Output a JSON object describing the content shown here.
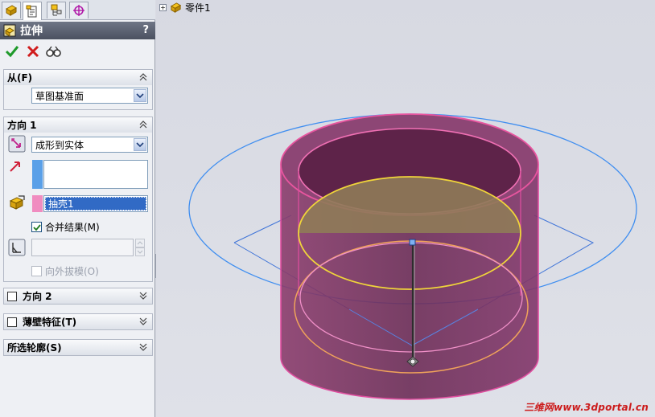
{
  "tabs": [
    {
      "name": "featuremanager-tab",
      "icon": "featuremanager-icon"
    },
    {
      "name": "propertymanager-tab",
      "icon": "propertymanager-icon"
    },
    {
      "name": "configurationmanager-tab",
      "icon": "configurationmanager-icon"
    },
    {
      "name": "dimxpert-tab",
      "icon": "dimxpert-icon"
    }
  ],
  "header": {
    "title": "拉伸",
    "help": "?"
  },
  "actions": {
    "ok": "ok-icon",
    "cancel": "cancel-icon",
    "preview": "detailed-preview-icon"
  },
  "from_group": {
    "title": "从(F)",
    "start_condition": "草图基准面"
  },
  "direction1": {
    "title": "方向 1",
    "end_condition": "成形到实体",
    "selected_body": "抽壳1",
    "merge_result": {
      "label": "合并结果(M)",
      "checked": true
    },
    "draft_outward": {
      "label": "向外拔模(O)",
      "checked": false,
      "enabled": false
    }
  },
  "direction2": {
    "title": "方向 2",
    "checked": false
  },
  "thin_feature": {
    "title": "薄壁特征(T)",
    "checked": false
  },
  "selected_contours": {
    "title": "所选轮廓(S)"
  },
  "tree": {
    "root": "零件1"
  },
  "watermark": "三维网www.3dportal.cn",
  "colors": {
    "header": "#4b5160",
    "direction_arrow": "#d0213a",
    "swatch_blue": "#5aa0e8",
    "swatch_pink": "#f08cc0",
    "model_pink": "#e04fa0",
    "model_body": "#7a3360",
    "ellipse_blue": "#3f8ef0",
    "section_yellow": "#f0d53a"
  }
}
